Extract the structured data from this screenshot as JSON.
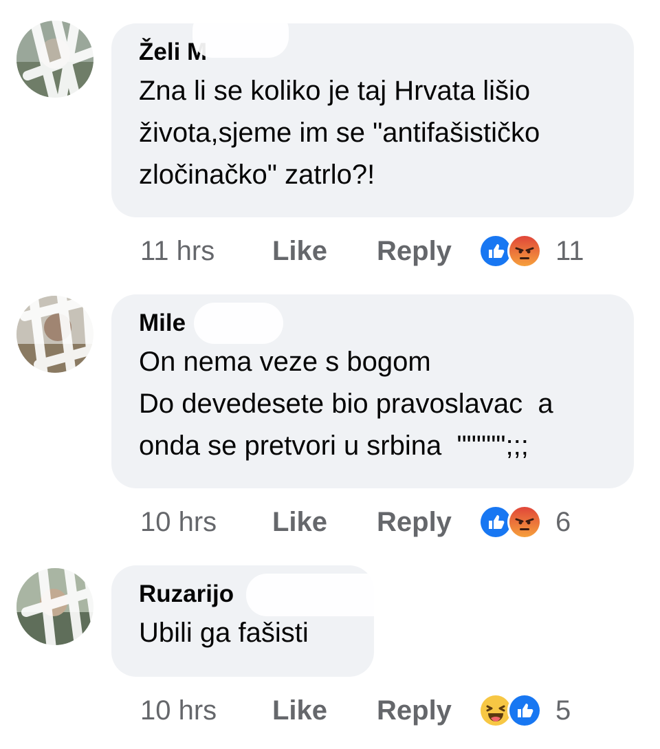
{
  "comments": [
    {
      "author": "Želi M",
      "lines": [
        "Zna li se koliko je taj Hrvata lišio",
        "života,sjeme im se \"antifašističko",
        "zločinačko\" zatrlo?!"
      ],
      "time": "11 hrs",
      "like_label": "Like",
      "reply_label": "Reply",
      "reactions": [
        "like",
        "angry"
      ],
      "reaction_count": "11"
    },
    {
      "author": "Mile",
      "lines": [
        "On nema veze s bogom",
        "Do devedesete bio pravoslavac  a",
        "onda se pretvori u srbina  \"\"\"\"\";;;"
      ],
      "time": "10 hrs",
      "like_label": "Like",
      "reply_label": "Reply",
      "reactions": [
        "like",
        "angry"
      ],
      "reaction_count": "6"
    },
    {
      "author": "Ruzarijo",
      "lines": [
        "Ubili ga fašisti"
      ],
      "time": "10 hrs",
      "like_label": "Like",
      "reply_label": "Reply",
      "reactions": [
        "haha",
        "like"
      ],
      "reaction_count": "5"
    }
  ],
  "colors": {
    "bubble": "#f0f2f5",
    "meta_text": "#65676b",
    "like_blue": "#1877f2",
    "angry_orange": "#f0573c",
    "haha_yellow": "#f7c744"
  }
}
